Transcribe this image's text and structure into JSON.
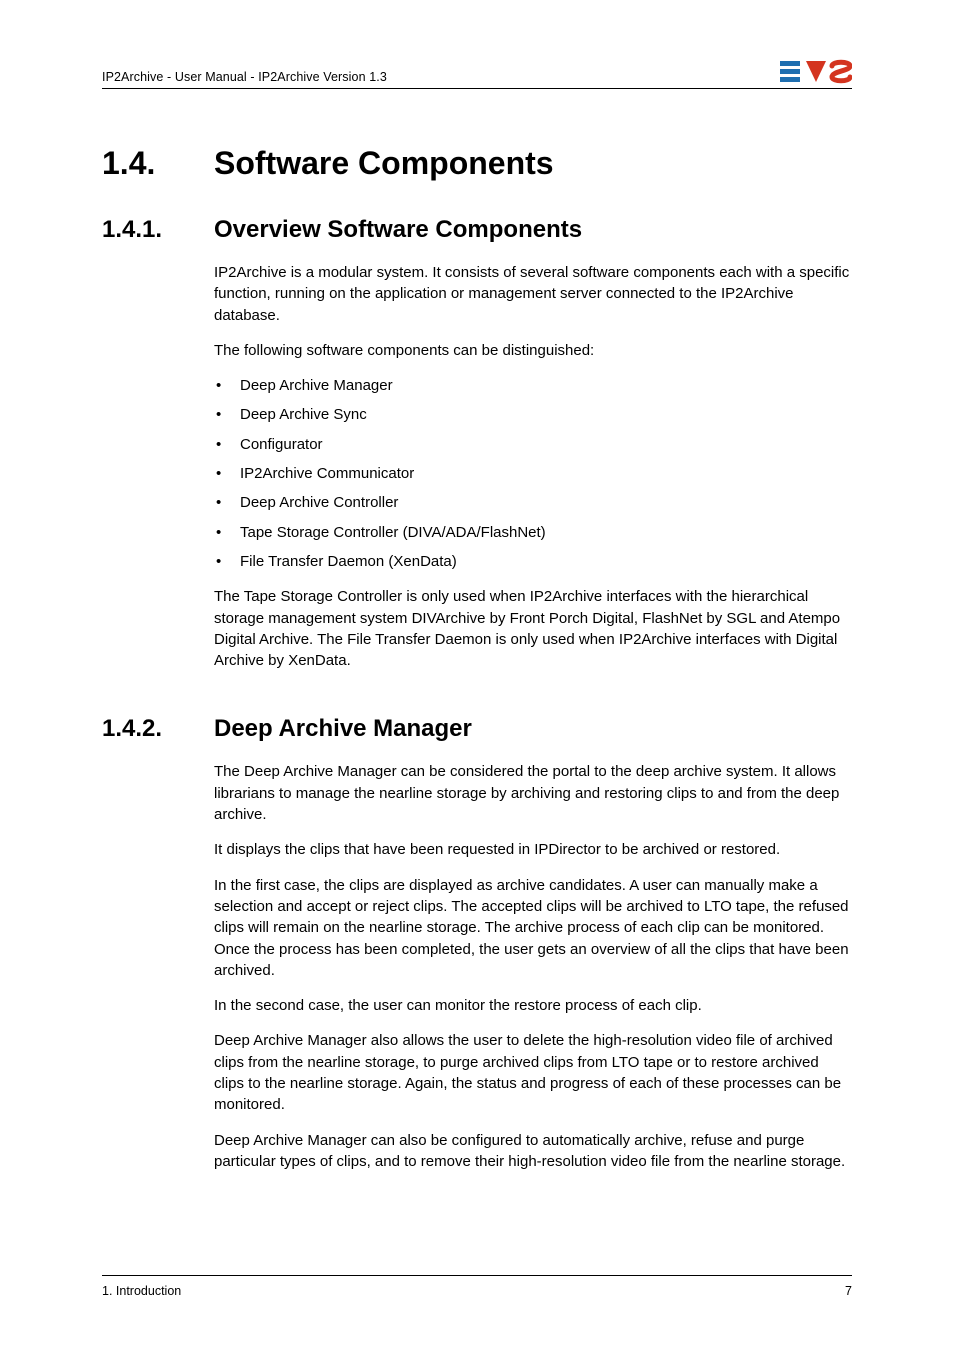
{
  "header": {
    "running": "IP2Archive - User Manual - IP2Archive Version 1.3"
  },
  "sections": {
    "s1": {
      "num": "1.4.",
      "title": "Software Components"
    },
    "s1_1": {
      "num": "1.4.1.",
      "title": "Overview Software Components",
      "p1": "IP2Archive is a modular system. It consists of several software components each with a specific function, running on the application or management server connected to the IP2Archive database.",
      "p2": "The following software components can be distinguished:",
      "bullets": [
        "Deep Archive Manager",
        "Deep Archive Sync",
        "Configurator",
        "IP2Archive Communicator",
        "Deep Archive Controller",
        "Tape Storage Controller (DIVA/ADA/FlashNet)",
        "File Transfer Daemon (XenData)"
      ],
      "p3": "The Tape Storage Controller is only used when IP2Archive interfaces with the hierarchical storage management system DIVArchive by Front Porch Digital, FlashNet by SGL and Atempo Digital Archive. The File Transfer Daemon is only used when IP2Archive interfaces with Digital  Archive by XenData."
    },
    "s1_2": {
      "num": "1.4.2.",
      "title": "Deep Archive Manager",
      "p1": "The Deep Archive Manager can be considered the portal to the deep archive system. It allows librarians to manage the nearline storage by archiving and restoring clips to and from the deep archive.",
      "p2": "It displays the clips that have been requested in IPDirector to be archived or restored.",
      "p3": "In the first case, the clips are displayed as archive candidates. A user can manually make a selection and accept or reject clips. The accepted clips will be archived to LTO tape, the refused clips will remain on the nearline storage. The archive process of each clip can be monitored. Once the process has been completed, the user gets an overview of all the clips that have been archived.",
      "p4": "In the second case, the user can monitor the restore process of each clip.",
      "p5": "Deep Archive Manager also allows the user to delete the high-resolution video file of archived clips from the nearline storage, to purge archived clips from LTO tape or to restore archived clips to the nearline storage. Again, the status and progress of each of these processes can be monitored.",
      "p6": "Deep Archive Manager can also be configured to automatically archive, refuse and purge particular types of clips, and to remove their high-resolution video file from the nearline storage."
    }
  },
  "footer": {
    "left": "1. Introduction",
    "right": "7"
  }
}
